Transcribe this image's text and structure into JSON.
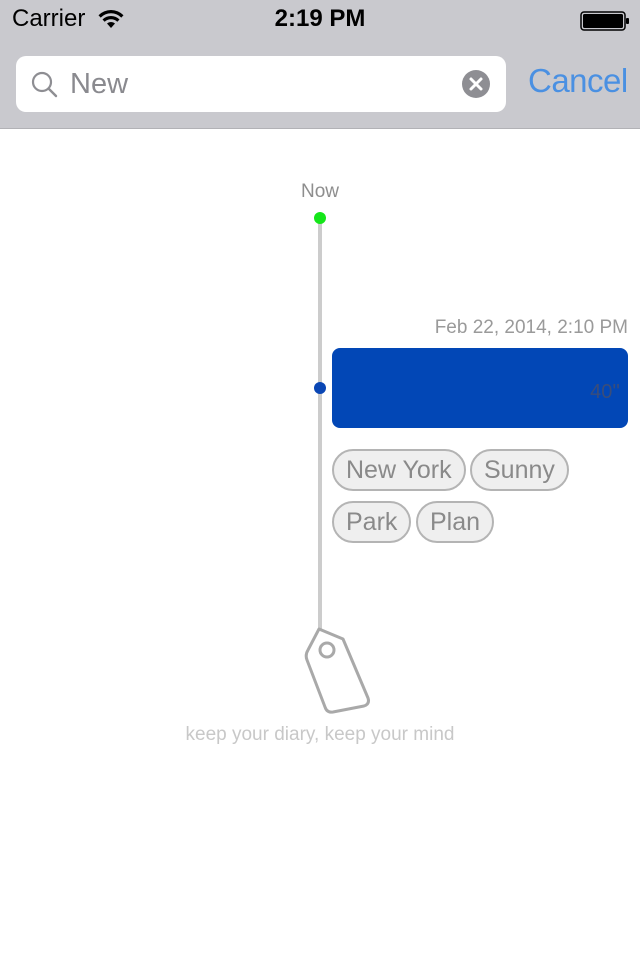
{
  "status_bar": {
    "carrier": "Carrier",
    "time": "2:19 PM",
    "wifi_icon": "wifi-icon",
    "battery_icon": "battery-full-icon"
  },
  "search": {
    "value": "New",
    "placeholder": "Search",
    "search_icon": "search-icon",
    "clear_icon": "clear-icon",
    "cancel_label": "Cancel"
  },
  "timeline": {
    "now_label": "Now",
    "entries": [
      {
        "date": "Feb 22, 2014, 2:10 PM",
        "duration": "40''",
        "color": "#0247b6",
        "tags": [
          "New York",
          "Sunny",
          "Park",
          "Plan"
        ]
      }
    ]
  },
  "footer": {
    "logo_icon": "tag-icon",
    "tagline": "keep your diary, keep your mind"
  },
  "colors": {
    "accent": "#4a90e2",
    "now_dot": "#15e61a",
    "entry_dot": "#0a46b4",
    "timeline_line": "#cccccc"
  }
}
